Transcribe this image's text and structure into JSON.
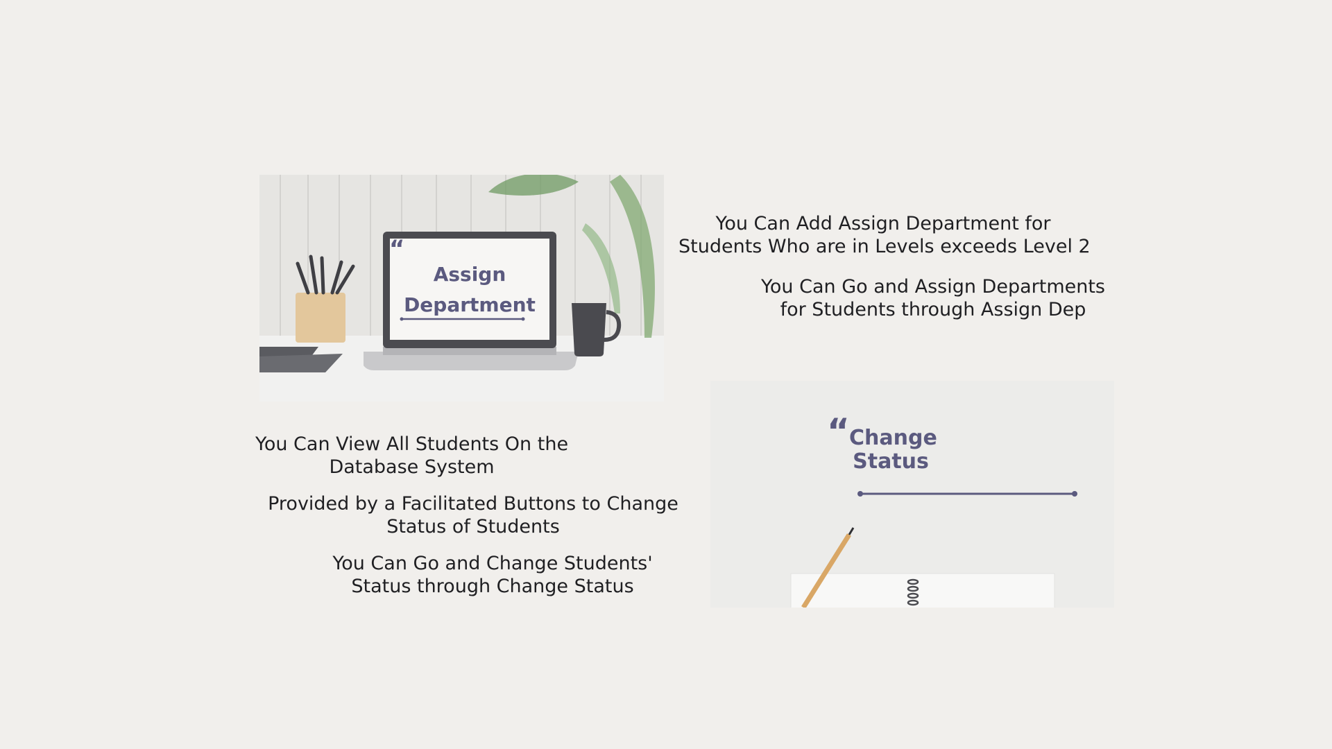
{
  "assign_panel": {
    "title_line1": "Assign",
    "title_line2": "Department"
  },
  "change_panel": {
    "title_line1": "Change",
    "title_line2": "Status"
  },
  "text_blocks": {
    "add_assign": {
      "line1": "You Can Add Assign Department for",
      "line2": "Students Who are in Levels exceeds Level 2"
    },
    "go_assign": {
      "line1": "You Can Go and Assign Departments",
      "line2": "for Students through Assign Dep"
    },
    "view_students": {
      "line1": "You Can View All Students On the",
      "line2": "Database System"
    },
    "buttons": {
      "line1": "Provided by a Facilitated Buttons to Change",
      "line2": "Status of Students"
    },
    "go_change": {
      "line1": "You Can Go and Change Students'",
      "line2": "Status through Change Status"
    }
  },
  "colors": {
    "background": "#f1efec",
    "accent": "#5b5a7f",
    "text": "#1f1f22"
  }
}
